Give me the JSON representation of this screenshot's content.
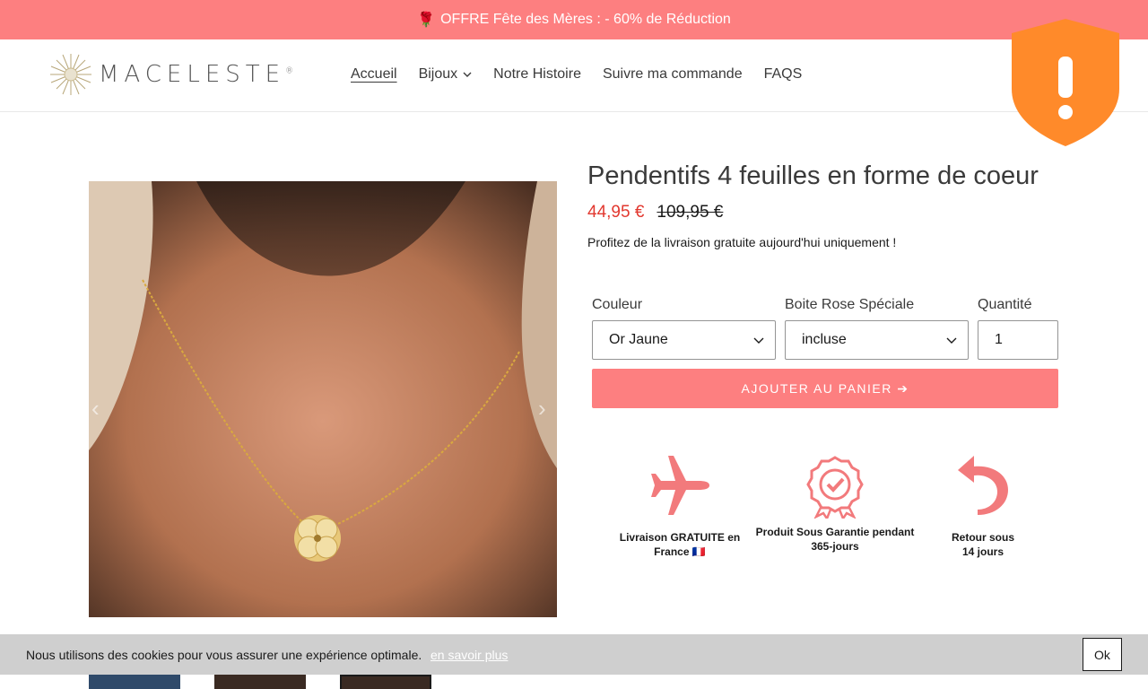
{
  "promo": {
    "icon": "rose-icon",
    "text": "OFFRE Fête des Mères : - 60% de Réduction"
  },
  "header": {
    "logo_text": "MACELESTE",
    "logo_mark": "®",
    "nav": [
      {
        "label": "Accueil",
        "active": true
      },
      {
        "label": "Bijoux",
        "has_dropdown": true
      },
      {
        "label": "Notre Histoire"
      },
      {
        "label": "Suivre ma commande"
      },
      {
        "label": "FAQS"
      }
    ],
    "warning_icon": "shield-warning-icon"
  },
  "product": {
    "title": "Pendentifs 4 feuilles en forme de coeur",
    "price_sale": "44,95 €",
    "price_old": "109,95 €",
    "shipping_note": "Profitez de la livraison gratuite aujourd'hui uniquement !",
    "options": {
      "color_label": "Couleur",
      "color_value": "Or Jaune",
      "box_label": "Boite Rose Spéciale",
      "box_value": "incluse",
      "qty_label": "Quantité",
      "qty_value": "1"
    },
    "add_to_cart": "AJOUTER AU PANIER ➔"
  },
  "badges": [
    {
      "icon": "airplane-icon",
      "line1": "Livraison GRATUITE en",
      "line2": "France 🇫🇷"
    },
    {
      "icon": "guarantee-seal-icon",
      "line1": "Produit Sous Garantie pendant",
      "line2": "365-jours"
    },
    {
      "icon": "return-arrow-icon",
      "line1": "Retour sous",
      "line2": "14 jours"
    }
  ],
  "cookie": {
    "text": "Nous utilisons des cookies pour vous assurer une expérience optimale.",
    "link": "en savoir plus",
    "ok": "Ok"
  },
  "colors": {
    "accent": "#fd7f80",
    "sale": "#e2382f",
    "shield": "#ff8a2a"
  }
}
